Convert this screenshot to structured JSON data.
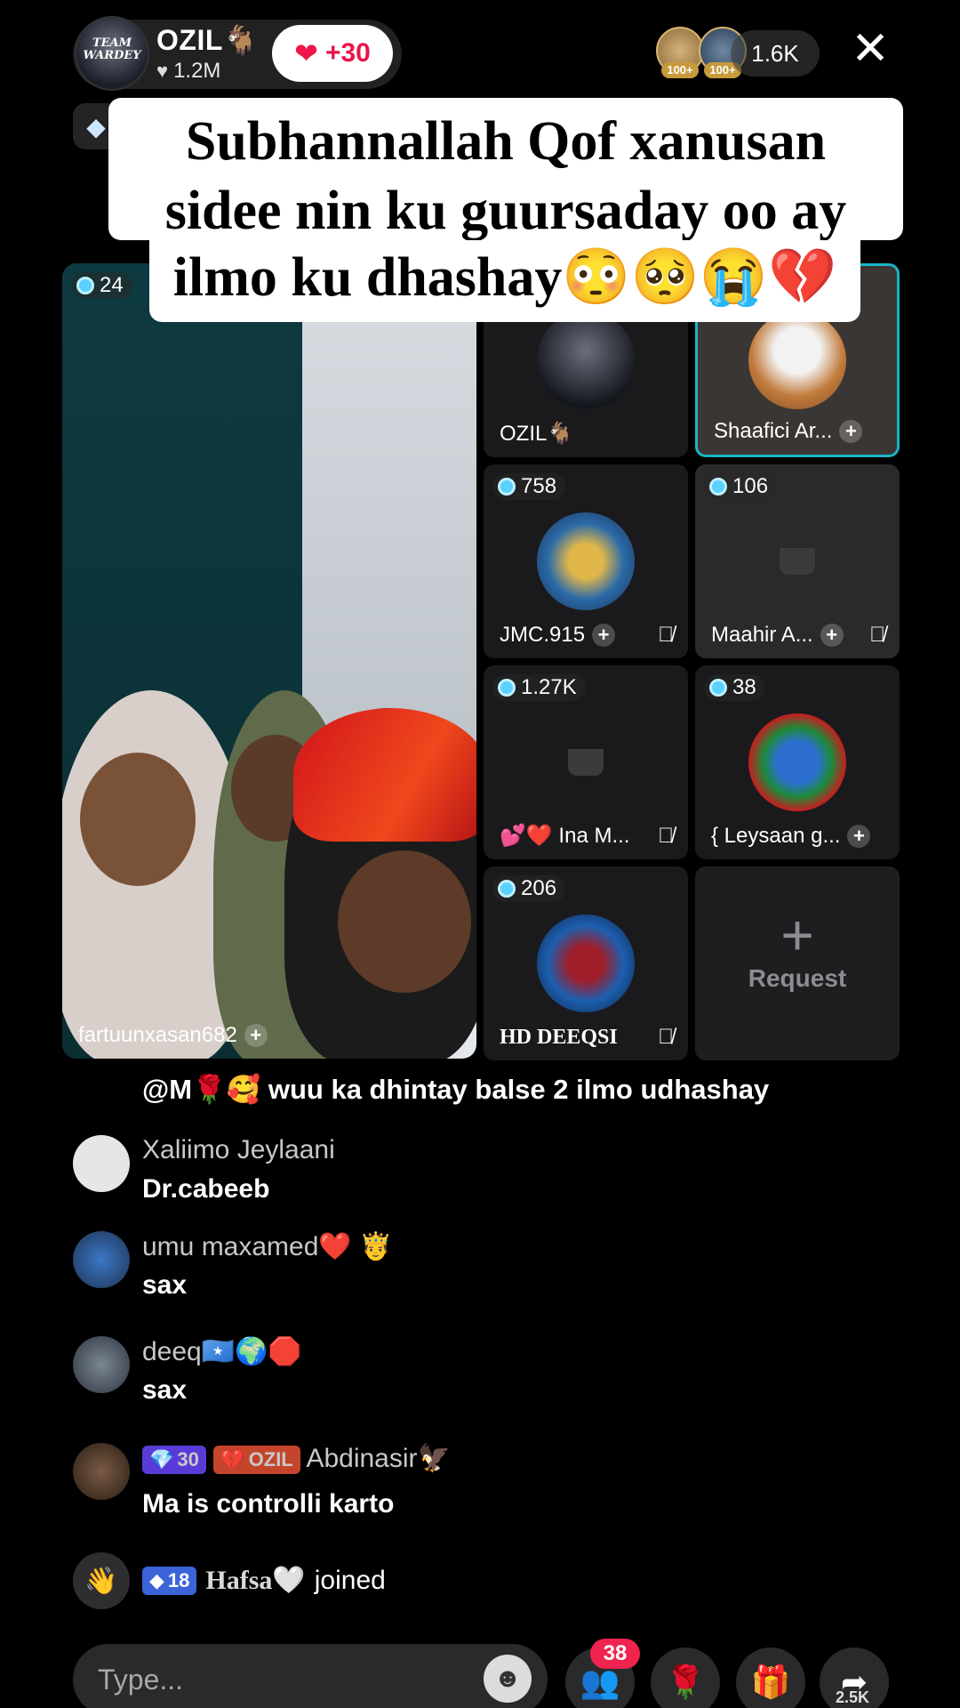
{
  "header": {
    "host_name": "OZIL🐐",
    "host_likes": "1.2M",
    "host_logo_text": "TEAM WARDEY",
    "follow_label": "+30",
    "viewer_badges": [
      "100+",
      "100+"
    ],
    "viewer_count": "1.6K",
    "close_icon": "close-icon"
  },
  "caption": {
    "line1": "Subhannallah Qof xanusan",
    "line2": "sidee nin ku guursaday oo ay",
    "line3": "ilmo ku dhashay😳🥺😭💔"
  },
  "grid": {
    "main": {
      "count": "24",
      "name": "fartuunxasan682"
    },
    "tiles": [
      {
        "name": "OZIL🐐",
        "count": "",
        "muted": false,
        "plus": false
      },
      {
        "name": "Shaafici Ar...",
        "count": "",
        "muted": false,
        "plus": true,
        "highlighted": true
      },
      {
        "name": "JMC.915",
        "count": "758",
        "muted": true,
        "plus": true
      },
      {
        "name": "Maahir A...",
        "count": "106",
        "muted": true,
        "plus": true
      },
      {
        "name": "💕❤️ Ina M...",
        "count": "1.27K",
        "muted": true,
        "plus": false
      },
      {
        "name": "{ Leysaan g...",
        "count": "38",
        "muted": false,
        "plus": true
      },
      {
        "name": "HD DEEQSI",
        "count": "206",
        "muted": true,
        "plus": false
      }
    ],
    "request_label": "Request"
  },
  "comments": {
    "partial": "@M🌹🥰 wuu ka dhintay balse 2 ilmo udhashay",
    "items": [
      {
        "user": "Xaliimo Jeylaani",
        "text": "Dr.cabeeb"
      },
      {
        "user": "umu maxamed❤️ 🤴",
        "text": "sax"
      },
      {
        "user": "deeq🇸🇴🌍🛑",
        "text": "sax"
      },
      {
        "user": "Abdinasir🦅",
        "text": "Ma is controlli karto",
        "gem_level": "30",
        "fan_badge": "OZIL"
      }
    ],
    "joined": {
      "level": "18",
      "user": "Hafsa🤍",
      "text": "joined"
    }
  },
  "bottom_bar": {
    "input_placeholder": "Type...",
    "match_count": "38",
    "share_count": "2.5K"
  },
  "colors": {
    "accent_pink": "#f0244e",
    "highlight_teal": "#19b4c4",
    "gem_purple": "#5b3bd8"
  }
}
